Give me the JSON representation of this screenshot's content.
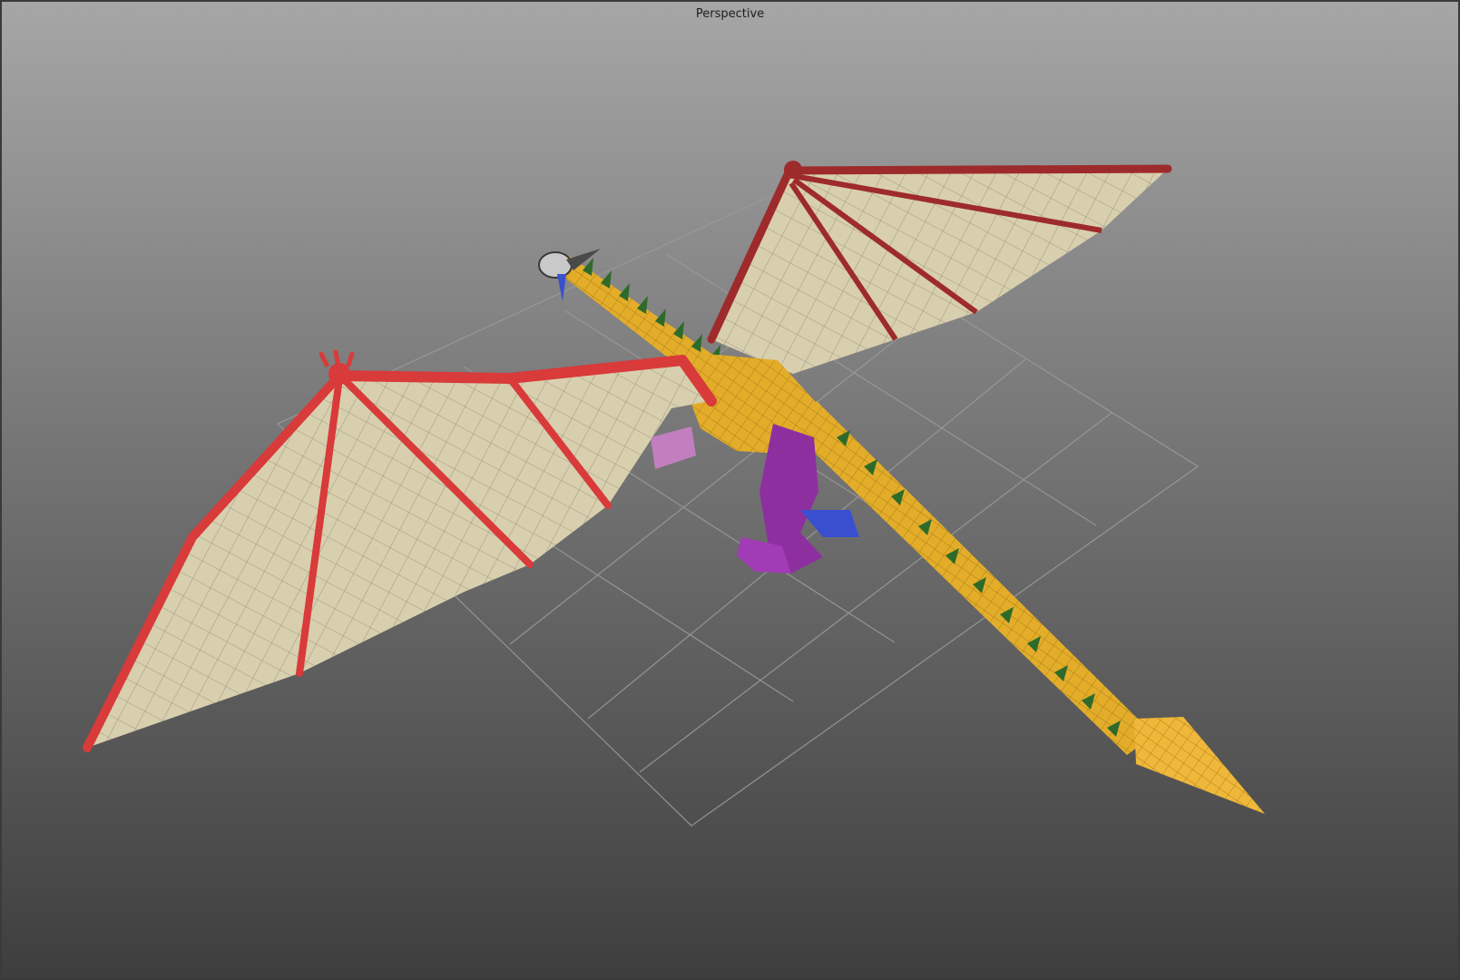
{
  "viewport": {
    "label": "Perspective"
  },
  "colors": {
    "wing_membrane": "#d8cfae",
    "wing_bone": "#d93a3a",
    "wing_bone_far": "#9e2b2b",
    "body": "#e3ad2a",
    "belly": "#8e2f9f",
    "spikes": "#2e6b2a",
    "claws_blue": "#3a4fd0",
    "grid": "#9a9a9a"
  }
}
